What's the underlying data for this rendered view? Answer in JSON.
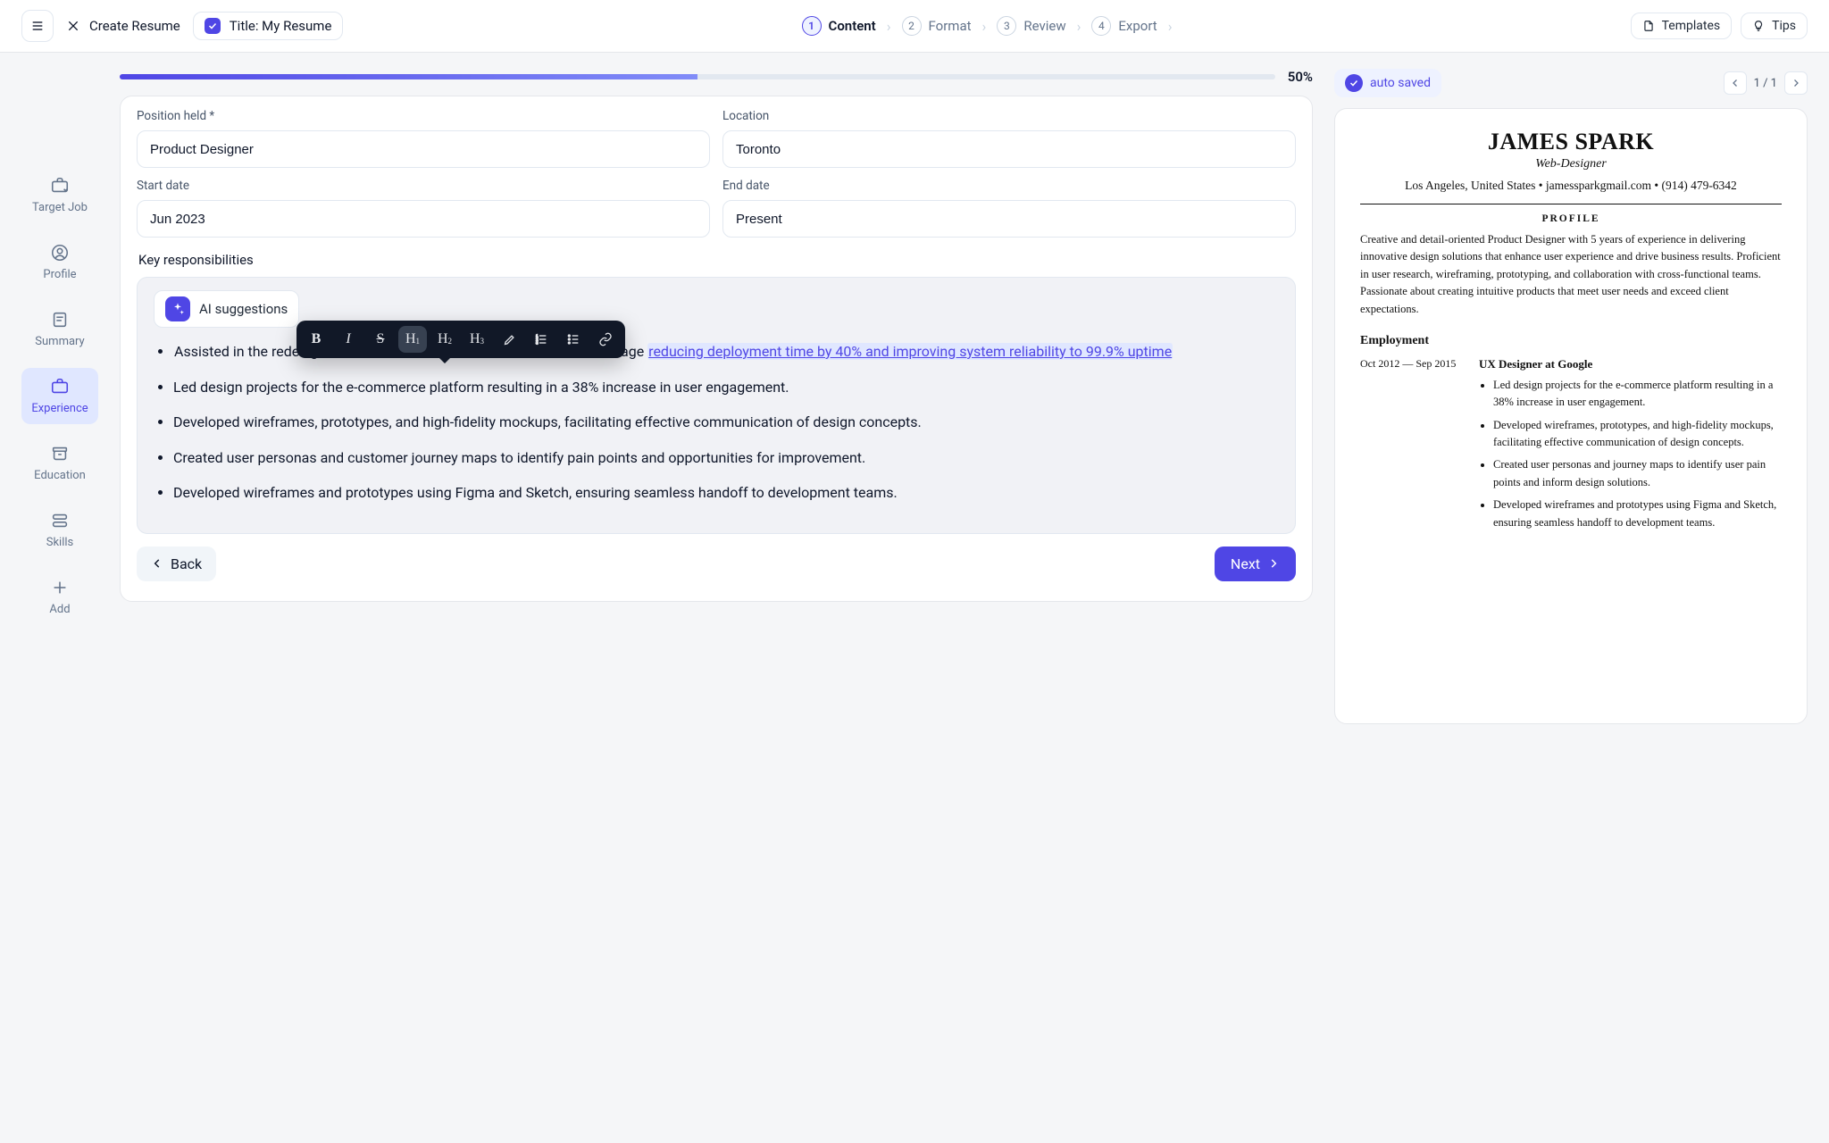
{
  "topbar": {
    "create_label": "Create Resume",
    "title_label": "Title: My Resume",
    "templates": "Templates",
    "tips": "Tips"
  },
  "steps": [
    {
      "num": "1",
      "label": "Content",
      "active": true
    },
    {
      "num": "2",
      "label": "Format"
    },
    {
      "num": "3",
      "label": "Review"
    },
    {
      "num": "4",
      "label": "Export"
    }
  ],
  "progress": {
    "pct_label": "50%",
    "pct": 50
  },
  "saved_label": "auto saved",
  "pager": {
    "text": "1 / 1"
  },
  "sidenav": [
    {
      "label": "Target Job"
    },
    {
      "label": "Profile"
    },
    {
      "label": "Summary"
    },
    {
      "label": "Experience",
      "active": true
    },
    {
      "label": "Education"
    },
    {
      "label": "Skills"
    },
    {
      "label": "Add"
    }
  ],
  "form": {
    "position_label": "Position held *",
    "position_value": "Product Designer",
    "location_label": "Location",
    "location_value": "Toronto",
    "start_label": "Start date",
    "start_value": "Jun 2023",
    "end_label": "End date",
    "end_value": "Present",
    "responsibilities_label": "Key responsibilities",
    "ai_label": "AI suggestions"
  },
  "nav": {
    "back": "Back",
    "next": "Next"
  },
  "editor": {
    "first_prefix": "Assisted in the redesign of the ",
    "hidden_mid": "ercentage",
    "selected": " reducing deployment time by 40% and improving system reliability to 99.9% uptime",
    "items": [
      "Led design projects for the e-commerce platform resulting in a 38% increase in user engagement.",
      "Developed wireframes, prototypes, and high-fidelity mockups, facilitating effective communication of design concepts.",
      "Created user personas and customer journey maps to identify pain points and opportunities for improvement.",
      "Developed wireframes and prototypes using Figma and Sketch, ensuring seamless handoff to development teams."
    ]
  },
  "resume": {
    "name": "JAMES SPARK",
    "subtitle": "Web-Designer",
    "contact": "Los Angeles, United States • jamessparkgmail.com • (914) 479-6342",
    "profile_h": "PROFILE",
    "profile": "Creative and detail-oriented Product Designer with 5 years of experience in delivering innovative design solutions that enhance user experience and drive business results. Proficient in user research, wireframing, prototyping, and collaboration with cross-functional teams. Passionate about creating intuitive products that meet user needs and exceed client expectations.",
    "employment_h": "Employment",
    "job": {
      "dates": "Oct 2012 — Sep 2015",
      "role": "UX Designer at Google",
      "bullets": [
        "Led design projects for the e-commerce platform resulting in a 38% increase in user engagement.",
        "Developed wireframes, prototypes, and high-fidelity mockups, facilitating effective communication of design concepts.",
        "Created user personas and journey maps to identify user pain points and inform design solutions.",
        "Developed wireframes and prototypes using Figma and Sketch, ensuring seamless handoff to development teams."
      ]
    }
  }
}
